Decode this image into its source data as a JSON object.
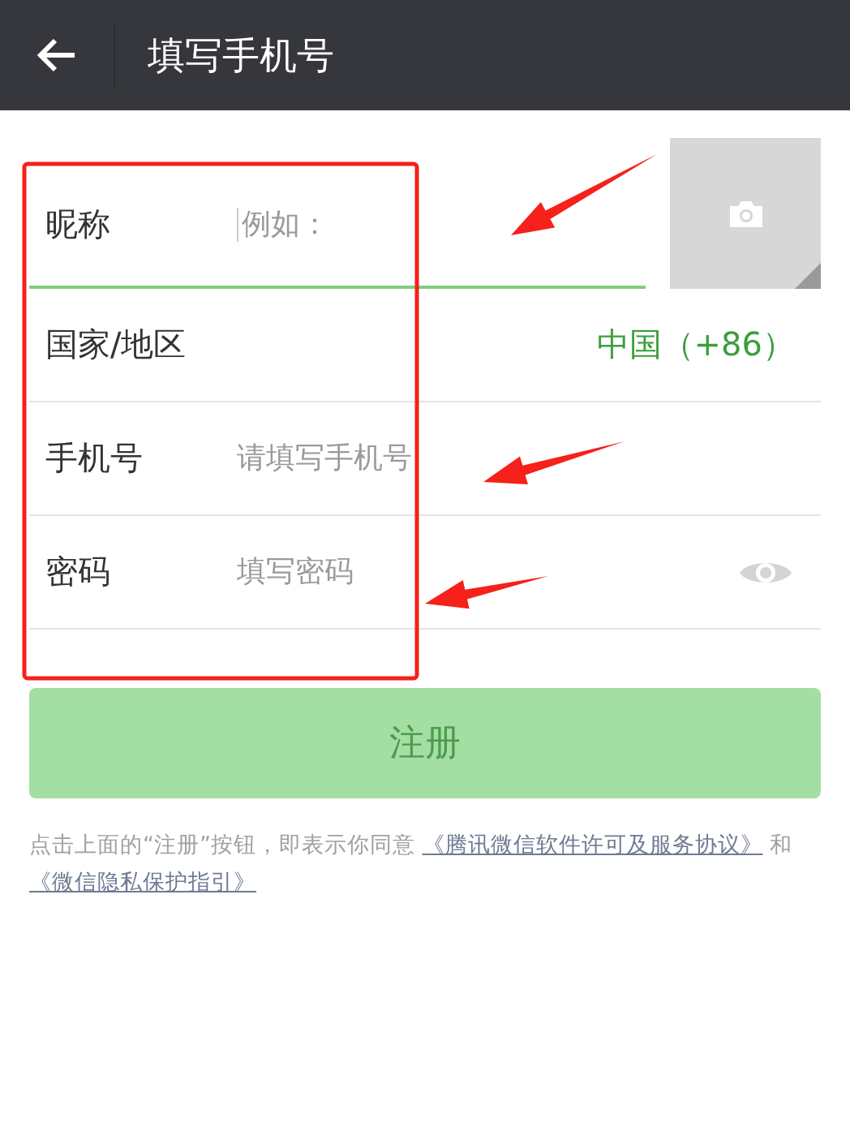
{
  "header": {
    "title": "填写手机号"
  },
  "form": {
    "rows": [
      {
        "kind": "input",
        "label": "昵称",
        "placeholder": "例如：",
        "focused": true
      },
      {
        "kind": "select",
        "label": "国家/地区",
        "value": "中国（+86）"
      },
      {
        "kind": "input",
        "label": "手机号",
        "placeholder": "请填写手机号",
        "focused": false
      },
      {
        "kind": "password",
        "label": "密码",
        "placeholder": "填写密码",
        "focused": false
      }
    ]
  },
  "register_button": {
    "label": "注册",
    "disabled": true
  },
  "agreement": [
    {
      "kind": "text",
      "text": "点击上面的“注册”按钮，即表示你同意 "
    },
    {
      "kind": "link",
      "text": "《腾讯微信软件许可及服务协议》"
    },
    {
      "kind": "text",
      "text": " 和 "
    },
    {
      "kind": "link",
      "text": "《微信隐私保护指引》"
    }
  ]
}
